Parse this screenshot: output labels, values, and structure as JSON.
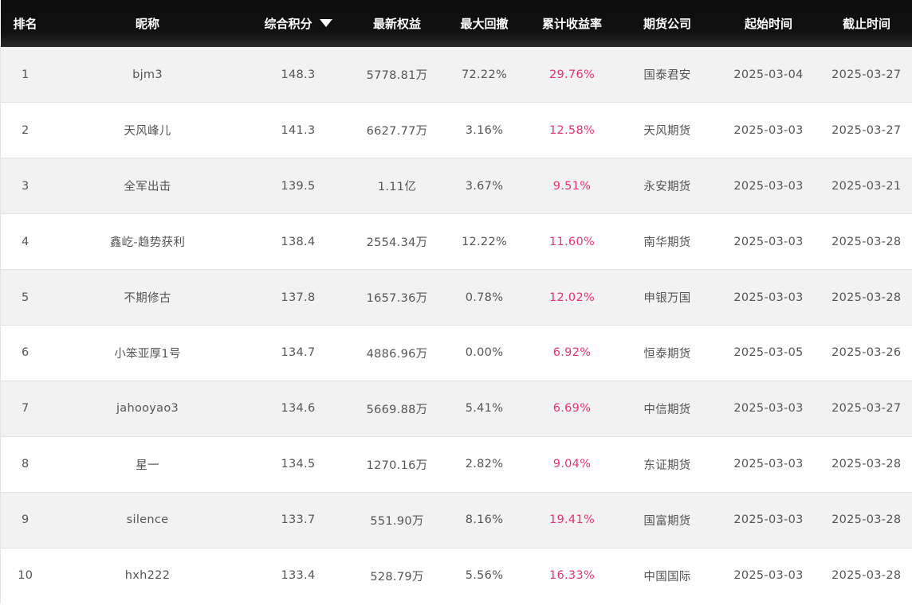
{
  "table": {
    "headers": {
      "rank": "排名",
      "nickname": "昵称",
      "score": "综合积分",
      "equity": "最新权益",
      "drawdown": "最大回撤",
      "return": "累计收益率",
      "broker": "期货公司",
      "start": "起始时间",
      "end": "截止时间"
    },
    "sort": {
      "column": "score",
      "direction": "desc",
      "icon": "caret-down-icon"
    },
    "rows": [
      {
        "rank": "1",
        "nickname": "bjm3",
        "score": "148.3",
        "equity": "5778.81万",
        "drawdown": "72.22%",
        "return": "29.76%",
        "broker": "国泰君安",
        "start": "2025-03-04",
        "end": "2025-03-27"
      },
      {
        "rank": "2",
        "nickname": "天风峰儿",
        "score": "141.3",
        "equity": "6627.77万",
        "drawdown": "3.16%",
        "return": "12.58%",
        "broker": "天风期货",
        "start": "2025-03-03",
        "end": "2025-03-27"
      },
      {
        "rank": "3",
        "nickname": "全军出击",
        "score": "139.5",
        "equity": "1.11亿",
        "drawdown": "3.67%",
        "return": "9.51%",
        "broker": "永安期货",
        "start": "2025-03-03",
        "end": "2025-03-21"
      },
      {
        "rank": "4",
        "nickname": "鑫屹-趋势获利",
        "score": "138.4",
        "equity": "2554.34万",
        "drawdown": "12.22%",
        "return": "11.60%",
        "broker": "南华期货",
        "start": "2025-03-03",
        "end": "2025-03-28"
      },
      {
        "rank": "5",
        "nickname": "不期修古",
        "score": "137.8",
        "equity": "1657.36万",
        "drawdown": "0.78%",
        "return": "12.02%",
        "broker": "申银万国",
        "start": "2025-03-03",
        "end": "2025-03-28"
      },
      {
        "rank": "6",
        "nickname": "小笨亚厚1号",
        "score": "134.7",
        "equity": "4886.96万",
        "drawdown": "0.00%",
        "return": "6.92%",
        "broker": "恒泰期货",
        "start": "2025-03-05",
        "end": "2025-03-26"
      },
      {
        "rank": "7",
        "nickname": "jahooyao3",
        "score": "134.6",
        "equity": "5669.88万",
        "drawdown": "5.41%",
        "return": "6.69%",
        "broker": "中信期货",
        "start": "2025-03-03",
        "end": "2025-03-27"
      },
      {
        "rank": "8",
        "nickname": "星一",
        "score": "134.5",
        "equity": "1270.16万",
        "drawdown": "2.82%",
        "return": "9.04%",
        "broker": "东证期货",
        "start": "2025-03-03",
        "end": "2025-03-28"
      },
      {
        "rank": "9",
        "nickname": "silence",
        "score": "133.7",
        "equity": "551.90万",
        "drawdown": "8.16%",
        "return": "19.41%",
        "broker": "国富期货",
        "start": "2025-03-03",
        "end": "2025-03-28"
      },
      {
        "rank": "10",
        "nickname": "hxh222",
        "score": "133.4",
        "equity": "528.79万",
        "drawdown": "5.56%",
        "return": "16.33%",
        "broker": "中国国际",
        "start": "2025-03-03",
        "end": "2025-03-28"
      }
    ]
  },
  "colors": {
    "header_bg": "#111111",
    "header_text": "#ffffff",
    "row_alt_bg": "#f2f2f2",
    "text": "#555555",
    "return_accent": "#e8336d"
  }
}
